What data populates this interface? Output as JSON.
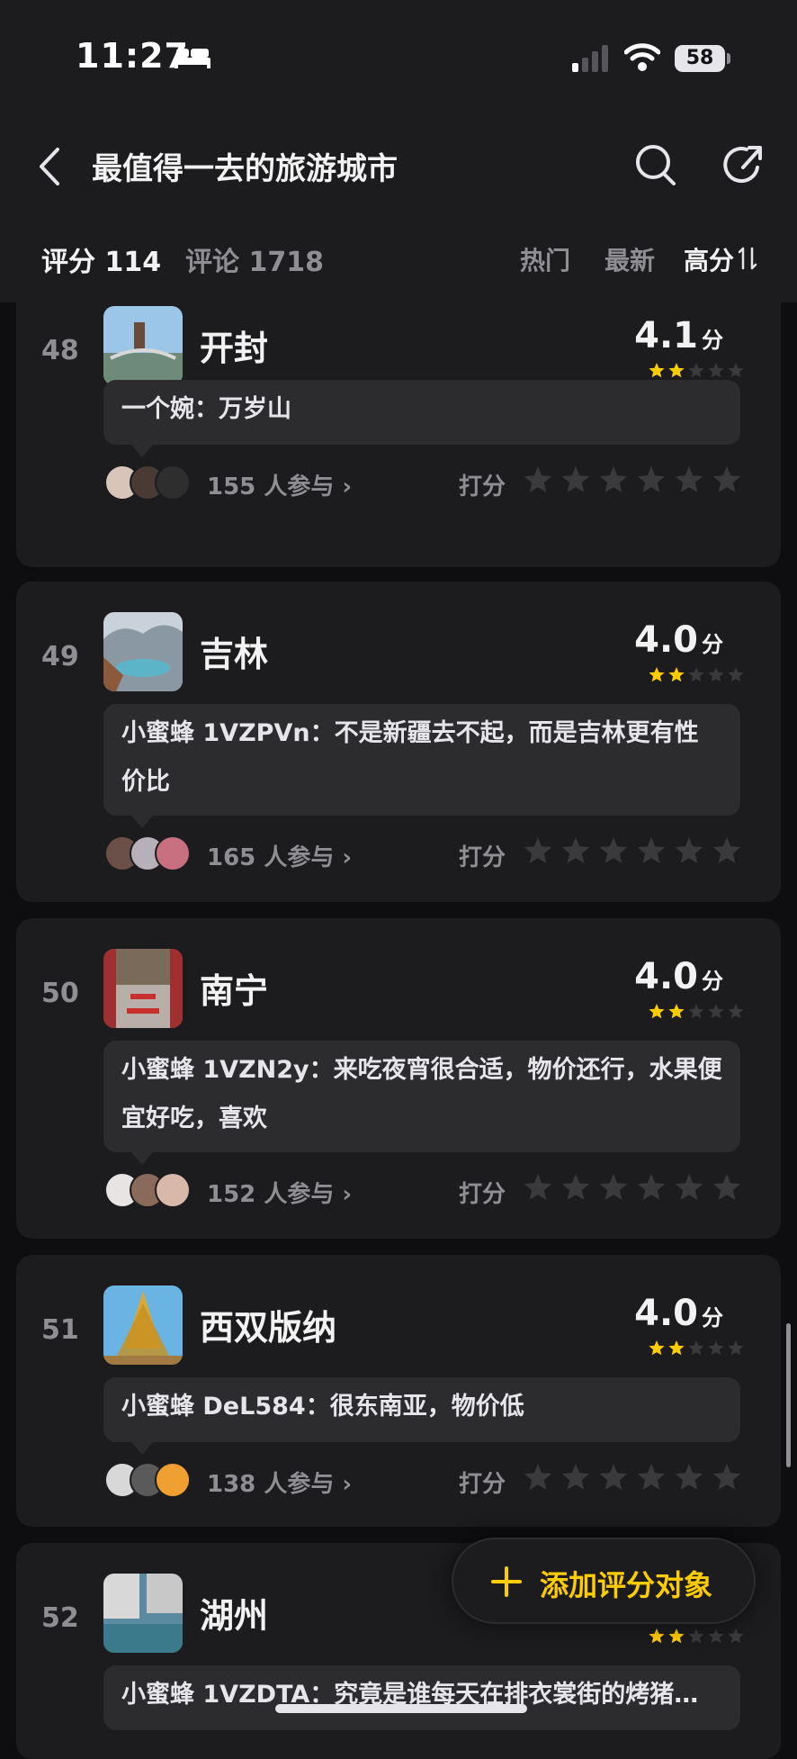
{
  "status": {
    "time": "11:27",
    "battery": "58"
  },
  "nav": {
    "title": "最值得一去的旅游城市"
  },
  "tabs": {
    "rating": "评分 114",
    "comments": "评论 1718"
  },
  "sort": {
    "hot": "热门",
    "new": "最新",
    "high": "高分"
  },
  "rate_label": "打分",
  "items": [
    {
      "rank": "48",
      "name": "开封",
      "score": "4.1",
      "unit": "分",
      "stars": 2,
      "comment": "一个婉：万岁山",
      "participants": "155 人参与"
    },
    {
      "rank": "49",
      "name": "吉林",
      "score": "4.0",
      "unit": "分",
      "stars": 2,
      "comment": "小蜜蜂 1VZPVn：不是新疆去不起，而是吉林更有性价比",
      "participants": "165 人参与"
    },
    {
      "rank": "50",
      "name": "南宁",
      "score": "4.0",
      "unit": "分",
      "stars": 2,
      "comment": "小蜜蜂 1VZN2y：来吃夜宵很合适，物价还行，水果便宜好吃，喜欢",
      "participants": "152 人参与"
    },
    {
      "rank": "51",
      "name": "西双版纳",
      "score": "4.0",
      "unit": "分",
      "stars": 2,
      "comment": "小蜜蜂 DeL584：很东南亚，物价低",
      "participants": "138 人参与"
    },
    {
      "rank": "52",
      "name": "湖州",
      "stars": 2,
      "comment": "小蜜蜂 1VZDTA：究竟是谁每天在排衣裳街的烤猪…"
    }
  ],
  "fab": {
    "label": "添加评分对象"
  },
  "colors": {
    "accent": "#ffcc00",
    "card": "#1c1c1e",
    "bubble": "#2c2c2e",
    "muted": "#8e8e93"
  }
}
